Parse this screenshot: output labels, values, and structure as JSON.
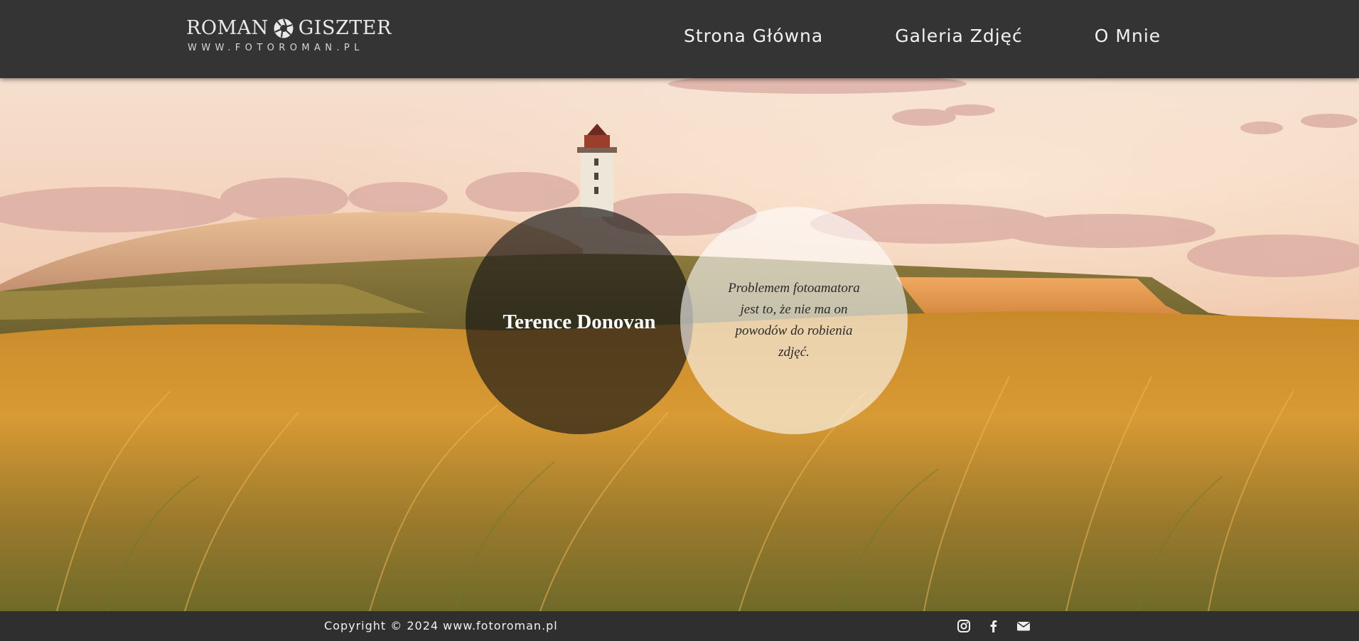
{
  "header": {
    "logo": {
      "left_word": "ROMAN",
      "right_word": "GISZTER",
      "subtitle": "WWW.FOTOROMAN.PL"
    },
    "nav": [
      {
        "label": "Strona Główna"
      },
      {
        "label": "Galeria Zdjęć"
      },
      {
        "label": "O Mnie"
      }
    ]
  },
  "hero": {
    "background": "lighthouse-dunes-sunset-photo",
    "author": "Terence Donovan",
    "quote": "Problemem fotoamatora jest to, że nie ma on powodów do robienia zdjęć."
  },
  "footer": {
    "copyright": "Copyright © 2024 www.fotoroman.pl",
    "social": [
      {
        "icon": "instagram-icon"
      },
      {
        "icon": "facebook-icon"
      },
      {
        "icon": "envelope-icon"
      }
    ]
  },
  "colors": {
    "header_bg": "#343434",
    "footer_bg": "#2f2f2f",
    "dark_circle": "rgba(20,20,20,0.66)",
    "light_circle": "rgba(255,255,255,0.60)"
  }
}
